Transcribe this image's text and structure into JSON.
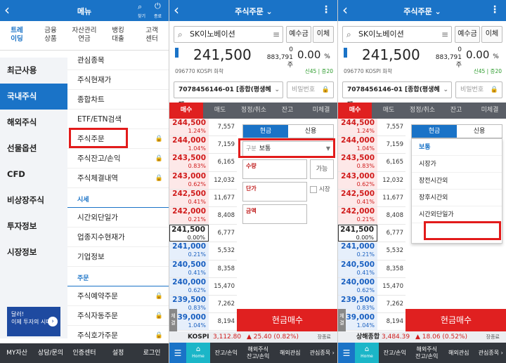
{
  "p1": {
    "title": "메뉴",
    "hdr_icons": [
      "찾기",
      "종료"
    ],
    "tabs": [
      "트레\n이딩",
      "금융\n상품",
      "자산관리\n연금",
      "뱅킹\n대출",
      "고객\n센터"
    ],
    "left_menu": [
      "최근사용",
      "국내주식",
      "해외주식",
      "선물옵션",
      "CFD",
      "비상장주식",
      "투자정보",
      "시장정보"
    ],
    "right_menu": [
      "관심종목",
      "주식현재가",
      "종합차트",
      "ETF/ETN검색",
      "주식주문",
      "주식잔고/손익",
      "주식체결내역"
    ],
    "section_market": "시세",
    "market_items": [
      "시간외단일가",
      "업종지수현재가",
      "기업정보"
    ],
    "section_order": "주문",
    "order_items": [
      "주식예약주문",
      "주식자동주문",
      "주식호가주문"
    ],
    "ad_text": "달러!\n이제 투자의 시대",
    "bottom": [
      "MY자산",
      "상담/문의",
      "인증센터",
      "설정",
      "로그인"
    ]
  },
  "order": {
    "title": "주식주문 ⌄",
    "search_value": "SK이노베이션",
    "btn_deposit": "예수금",
    "btn_transfer": "이체",
    "price": "241,500",
    "volume_top": "0",
    "volume_bottom": "883,791주",
    "change_pct": "0.00",
    "pct_sign": "%",
    "code_info": "096770  KOSPI  화학",
    "credit": "신45 | 증20",
    "account": "7078456146-01 [종합(평생혜택...",
    "password_placeholder": "비밀번호",
    "tabs": [
      "매수",
      "매도",
      "정정/취소",
      "잔고",
      "미체결"
    ],
    "book": [
      {
        "p": "244,500",
        "r": "1.24%",
        "v": "7,557",
        "t": "ask"
      },
      {
        "p": "244,000",
        "r": "1.04%",
        "v": "7,159",
        "t": "ask"
      },
      {
        "p": "243,500",
        "r": "0.83%",
        "v": "6,165",
        "t": "ask"
      },
      {
        "p": "243,000",
        "r": "0.62%",
        "v": "12,032",
        "t": "ask"
      },
      {
        "p": "242,500",
        "r": "0.41%",
        "v": "11,677",
        "t": "ask"
      },
      {
        "p": "242,000",
        "r": "0.21%",
        "v": "8,408",
        "t": "ask"
      },
      {
        "p": "241,500",
        "r": "0.00%",
        "v": "6,777",
        "t": "cur"
      },
      {
        "p": "241,000",
        "r": "0.21%",
        "v": "5,532",
        "t": "bid"
      },
      {
        "p": "240,500",
        "r": "0.41%",
        "v": "8,358",
        "t": "bid"
      },
      {
        "p": "240,000",
        "r": "0.62%",
        "v": "15,470",
        "t": "bid"
      },
      {
        "p": "239,500",
        "r": "0.83%",
        "v": "7,262",
        "t": "bid"
      },
      {
        "p": "239,000",
        "r": "1.04%",
        "v": "8,194",
        "t": "bid"
      }
    ],
    "seg_cash": "현금",
    "seg_credit": "신용",
    "type_key": "구분",
    "type_value": "보통",
    "qty_label": "수량",
    "price_label": "단가",
    "amount_label": "금액",
    "possible": "가능",
    "market_chk": "시장",
    "buy_btn": "현금매수",
    "side_btn": "체결",
    "bottom": [
      "잔고/손익",
      "해외주식\n잔고/손익",
      "해외관심",
      "관심종목 ›"
    ],
    "home": "Home",
    "menu": "메뉴"
  },
  "idx2": {
    "name": "KOSPI",
    "value": "3,112.80",
    "change": "▲ 25.40 (0.82%)",
    "end": "장종료"
  },
  "idx3": {
    "name": "상해종합",
    "value": "3,484.39",
    "change": "▲ 18.06 (0.52%)",
    "end": "장종료"
  },
  "dropdown": [
    "보통",
    "시장가",
    "장전시간외",
    "장후시간외",
    "시간외단일가"
  ]
}
